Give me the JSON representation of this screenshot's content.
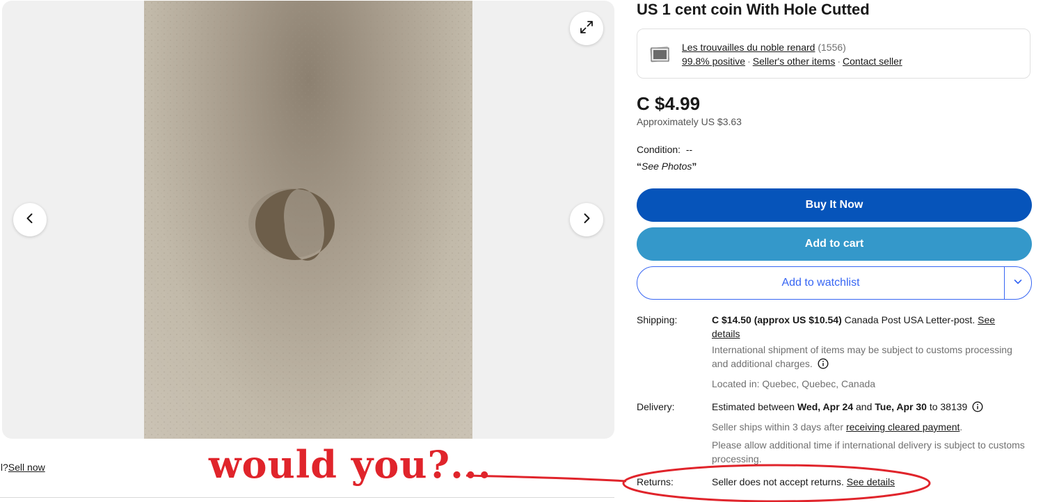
{
  "listing": {
    "title": "US 1 cent coin With Hole Cutted"
  },
  "seller": {
    "name": "Les trouvailles du noble renard",
    "feedback_count": "(1556)",
    "positive": "99.8% positive",
    "other_items": "Seller's other items",
    "contact": "Contact seller"
  },
  "price": {
    "main": "C $4.99",
    "approx": "Approximately US $3.63"
  },
  "condition": {
    "label": "Condition:",
    "value": "--",
    "note": "See Photos",
    "open_quote": "“",
    "close_quote": "”"
  },
  "actions": {
    "buy": "Buy It Now",
    "cart": "Add to cart",
    "watchlist": "Add to watchlist"
  },
  "shipping": {
    "label": "Shipping:",
    "cost": "C $14.50 (approx US $10.54)",
    "method": " Canada Post USA Letter-post. ",
    "see_details": "See details",
    "customs_note": "International shipment of items may be subject to customs processing and additional charges.",
    "located": "Located in: Quebec, Quebec, Canada"
  },
  "delivery": {
    "label": "Delivery:",
    "prefix": "Estimated between ",
    "start": "Wed, Apr 24",
    "mid": " and ",
    "end": "Tue, Apr 30",
    "to": " to 38139",
    "ships_prefix": "Seller ships within 3 days after ",
    "ships_link": "receiving cleared payment",
    "ships_suffix": ".",
    "intl_note": "Please allow additional time if international delivery is subject to customs processing."
  },
  "returns": {
    "label": "Returns:",
    "text": "Seller does not accept returns. ",
    "see_details": "See details"
  },
  "left_footer": {
    "partial": "ell? ",
    "sell_now": "Sell now"
  },
  "annotation": {
    "text": "would you?...",
    "color": "#e0242b"
  },
  "colors": {
    "buy": "#0654ba",
    "cart": "#3498ca",
    "watch_border": "#3665f3"
  },
  "icons": [
    "chevron-left-icon",
    "chevron-right-icon",
    "expand-icon",
    "info-icon",
    "chevron-down-icon"
  ]
}
